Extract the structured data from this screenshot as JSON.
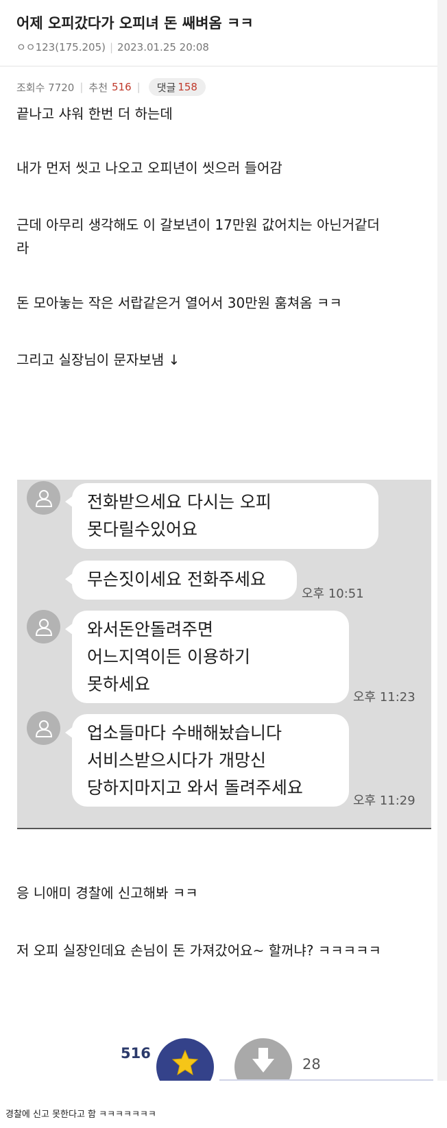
{
  "post": {
    "title": "어제 오피갔다가 오피녀 돈 쌔벼옴 ㅋㅋ",
    "author": "ㅇㅇ123(175.205)",
    "date": "2023.01.25 20:08",
    "views_label": "조회수 7720",
    "recommend_label": "추천",
    "recommend_count": "516",
    "comments_label": "댓글",
    "comments_count": "158"
  },
  "body": {
    "lines": [
      "끝나고 샤워 한번 더 하는데",
      "내가 먼저 씻고 나오고 오피년이 씻으러 들어감",
      "근데 아무리 생각해도 이 갈보년이 17만원 값어치는 아닌거같더",
      "라",
      "돈 모아놓는 작은 서랍같은거 열어서 30만원 훔쳐옴 ㅋㅋ",
      "그리고 실장님이 문자보냄 ↓",
      "응 니애미 경찰에 신고해봐 ㅋㅋ",
      "저 오피 실장인데요 손님이 돈 가져갔어요~ 할꺼냐? ㅋㅋㅋㅋㅋ"
    ]
  },
  "sms": {
    "messages": [
      {
        "lines": [
          "전화받으세요 다시는 오피",
          "못다릴수있어요"
        ],
        "time": ""
      },
      {
        "lines": [
          "무슨짓이세요 전화주세요"
        ],
        "time": "오후 10:51"
      },
      {
        "lines": [
          "와서돈안돌려주면",
          "어느지역이든 이용하기",
          "못하세요"
        ],
        "time": "오후 11:23"
      },
      {
        "lines": [
          "업소들마다 수배해놨습니다",
          "서비스받으시다가 개망신",
          "당하지마지고 와서 돌려주세요"
        ],
        "time": "오후 11:29"
      }
    ]
  },
  "votes": {
    "up_count": "516",
    "down_count": "28",
    "up_icon": "star-icon",
    "down_icon": "down-arrow-icon"
  },
  "caption": "경찰에 신고 못한다고 함 ㅋㅋㅋㅋㅋㅋㅋ",
  "colors": {
    "accent_red": "#c0392b",
    "vote_up": "#34428a",
    "vote_down": "#a9a9a9",
    "sms_bg": "#dcdcdc"
  }
}
